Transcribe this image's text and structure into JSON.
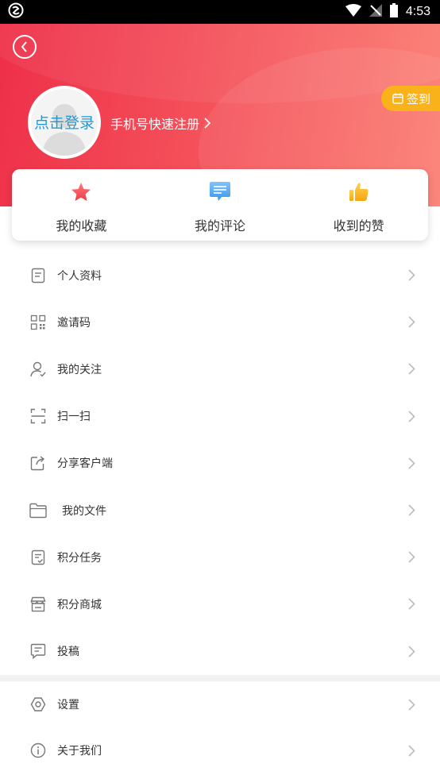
{
  "status_bar": {
    "time": "4:53"
  },
  "header": {
    "avatar_login": "点击登录",
    "register_link": "手机号快速注册",
    "signin_button": "签到"
  },
  "quick_actions": [
    {
      "label": "我的收藏",
      "icon": "star-icon",
      "color": "#f04f55"
    },
    {
      "label": "我的评论",
      "icon": "comment-icon",
      "color": "#4aa6f0"
    },
    {
      "label": "收到的赞",
      "icon": "thumbs-up-icon",
      "color": "#f9b21a"
    }
  ],
  "menu": [
    {
      "label": "个人资料",
      "icon": "profile-doc-icon"
    },
    {
      "label": "邀请码",
      "icon": "qr-code-icon"
    },
    {
      "label": "我的关注",
      "icon": "user-follow-icon"
    },
    {
      "label": "扫一扫",
      "icon": "scan-icon"
    },
    {
      "label": "分享客户端",
      "icon": "share-icon"
    },
    {
      "label": "我的文件",
      "icon": "folder-icon"
    },
    {
      "label": "积分任务",
      "icon": "task-icon"
    },
    {
      "label": "积分商城",
      "icon": "store-icon"
    },
    {
      "label": "投稿",
      "icon": "submit-icon"
    }
  ],
  "menu2": [
    {
      "label": "设置",
      "icon": "settings-icon"
    },
    {
      "label": "关于我们",
      "icon": "info-icon"
    }
  ],
  "colors": {
    "header_gradient_start": "#ee2f48",
    "header_gradient_end": "#fb7d72",
    "signin_bg": "#f9b21a",
    "login_text": "#1f9ad6"
  }
}
